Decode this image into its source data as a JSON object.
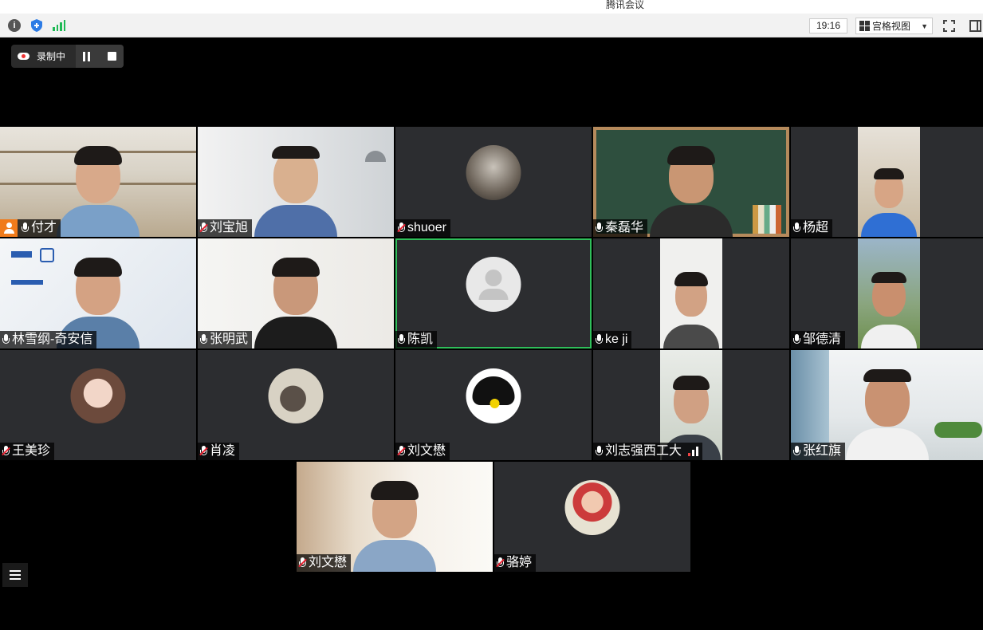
{
  "window": {
    "title": "腾讯会议"
  },
  "toolbar": {
    "info_icon": "info-icon",
    "security_icon": "shield-icon",
    "network_icon": "signal-icon",
    "time": "19:16",
    "view_label": "宫格视图",
    "fullscreen_icon": "fullscreen-icon",
    "sidebar_icon": "sidebar-toggle-icon"
  },
  "recording": {
    "label": "录制中",
    "pause_icon": "pause-icon",
    "stop_icon": "stop-icon"
  },
  "participants": [
    {
      "name": "付才",
      "host": true,
      "muted": false,
      "kind": "video"
    },
    {
      "name": "刘宝旭",
      "muted": true,
      "kind": "video"
    },
    {
      "name": "shuoer",
      "muted": true,
      "kind": "avatar"
    },
    {
      "name": "秦磊华",
      "muted": false,
      "kind": "video"
    },
    {
      "name": "杨超",
      "muted": false,
      "kind": "video"
    },
    {
      "name": "林雪纲-奇安信",
      "muted": false,
      "kind": "video"
    },
    {
      "name": "张明武",
      "muted": false,
      "kind": "video"
    },
    {
      "name": "陈凯",
      "muted": false,
      "kind": "avatar",
      "active_speaker": true
    },
    {
      "name": "ke ji",
      "muted": false,
      "kind": "video"
    },
    {
      "name": "邹德清",
      "muted": false,
      "kind": "video"
    },
    {
      "name": "王美珍",
      "muted": true,
      "kind": "avatar"
    },
    {
      "name": "肖凌",
      "muted": true,
      "kind": "avatar"
    },
    {
      "name": "刘文懋",
      "muted": true,
      "kind": "avatar"
    },
    {
      "name": "刘志强西工大",
      "muted": false,
      "kind": "video",
      "weak_network": true
    },
    {
      "name": "张红旗",
      "muted": false,
      "kind": "video"
    },
    {
      "name": "刘文懋",
      "muted": true,
      "kind": "video"
    },
    {
      "name": "骆婷",
      "muted": true,
      "kind": "avatar"
    }
  ],
  "bottom": {
    "list_icon": "participant-list-icon"
  }
}
